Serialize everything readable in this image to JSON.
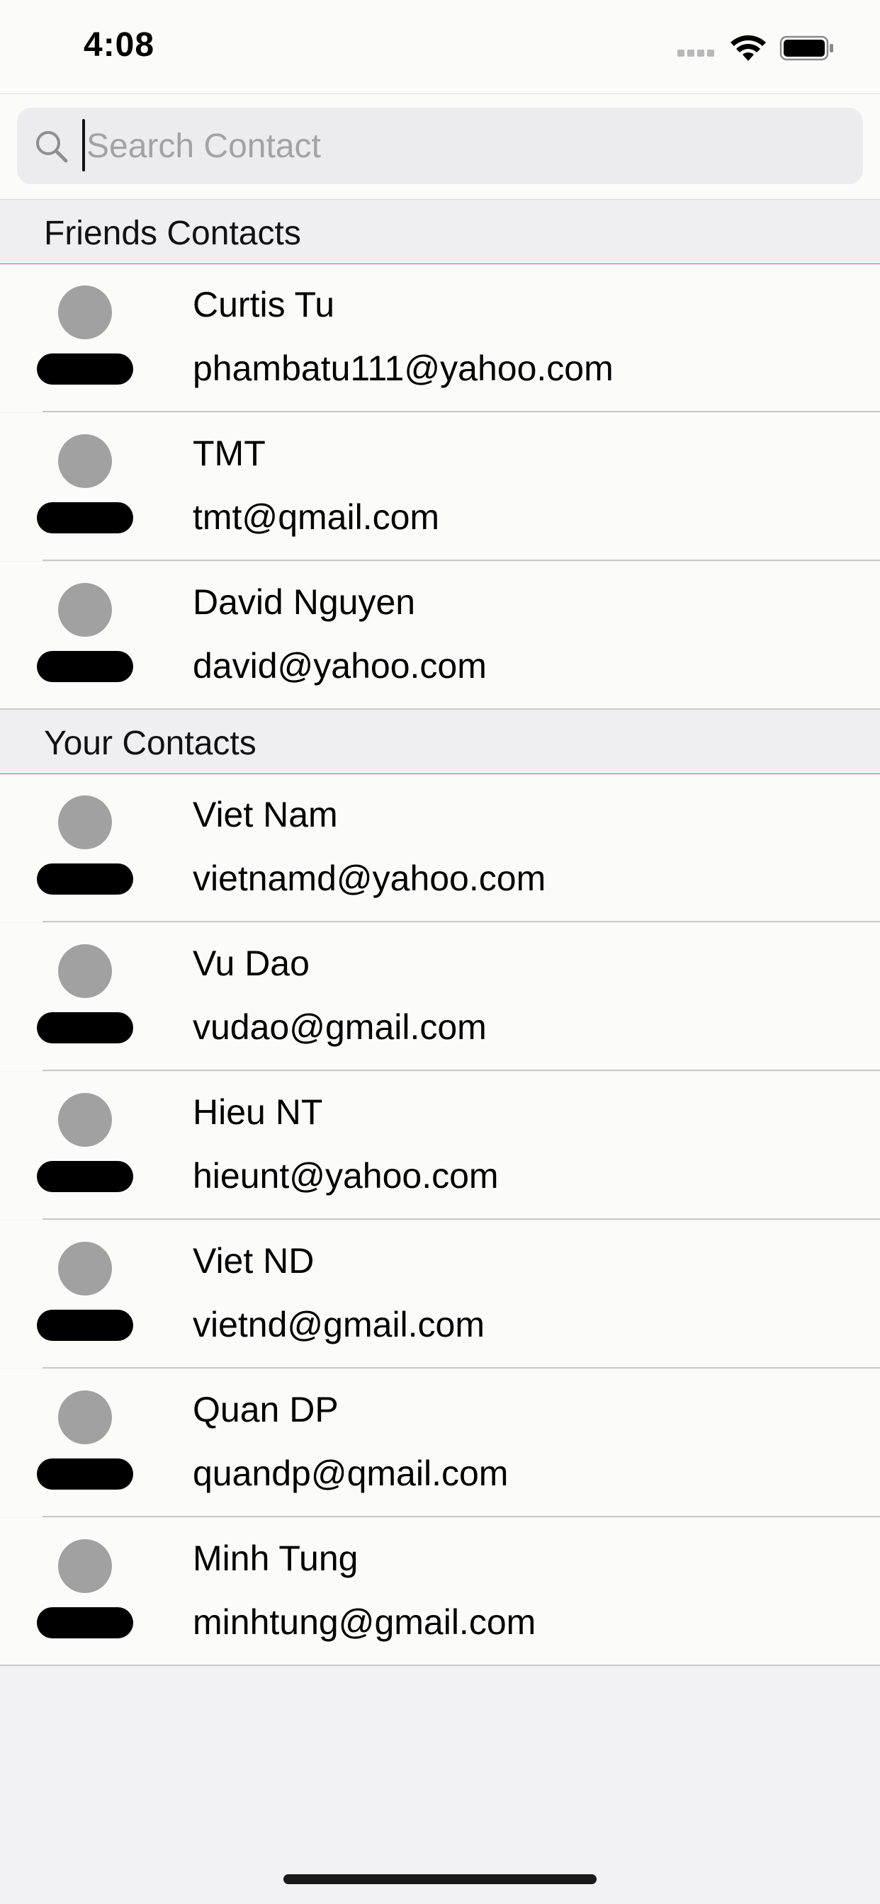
{
  "status_bar": {
    "time": "4:08"
  },
  "search": {
    "placeholder": "Search Contact",
    "value": ""
  },
  "sections": [
    {
      "title": "Friends Contacts",
      "contacts": [
        {
          "name": "Curtis Tu",
          "email": "phambatu111@yahoo.com"
        },
        {
          "name": "TMT",
          "email": "tmt@qmail.com"
        },
        {
          "name": "David Nguyen",
          "email": "david@yahoo.com"
        }
      ]
    },
    {
      "title": "Your Contacts",
      "contacts": [
        {
          "name": "Viet Nam",
          "email": "vietnamd@yahoo.com"
        },
        {
          "name": "Vu Dao",
          "email": "vudao@gmail.com"
        },
        {
          "name": "Hieu NT",
          "email": "hieunt@yahoo.com"
        },
        {
          "name": "Viet ND",
          "email": "vietnd@gmail.com"
        },
        {
          "name": "Quan DP",
          "email": "quandp@qmail.com"
        },
        {
          "name": "Minh Tung",
          "email": "minhtung@gmail.com"
        }
      ]
    }
  ],
  "icons": {
    "search": "search-icon",
    "wifi": "wifi-icon",
    "battery": "battery-icon",
    "signal": "cellular-signal-icon",
    "avatar": "person-placeholder-icon"
  },
  "colors": {
    "section_divider": "#e8468a",
    "avatar_head": "#a1a1a1",
    "avatar_body": "#000000",
    "background": "#f2f2f4"
  }
}
